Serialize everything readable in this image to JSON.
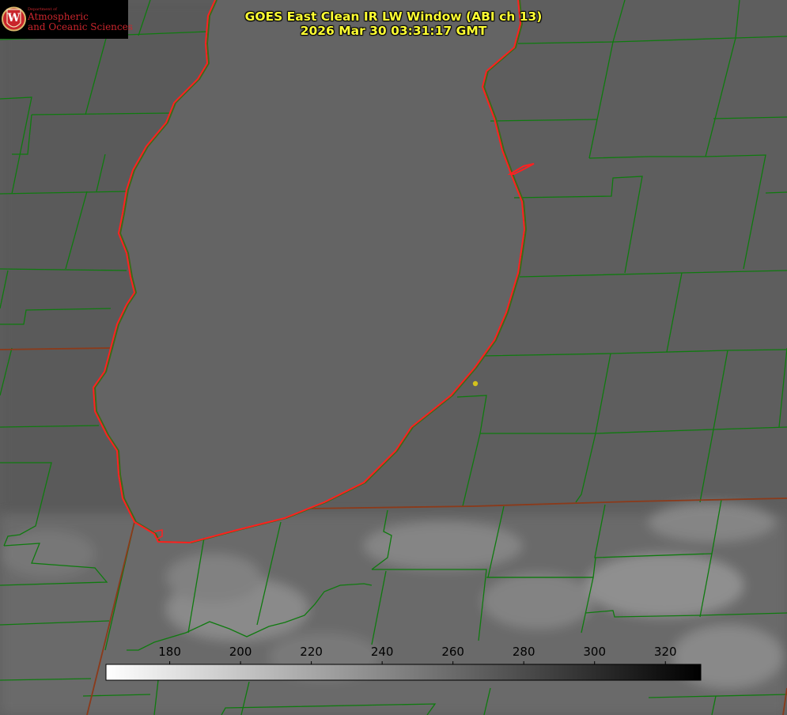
{
  "title": "GOES East Clean IR LW Window (ABI ch 13)",
  "timestamp": "2026 Mar 30 03:31:17 GMT",
  "logo": {
    "department": "Department of",
    "name_line1": "Atmospheric",
    "name_line2": "and Oceanic Sciences",
    "seal_letter": "W"
  },
  "colorbar": {
    "ticks": [
      {
        "label": "180",
        "value": 180
      },
      {
        "label": "200",
        "value": 200
      },
      {
        "label": "220",
        "value": 220
      },
      {
        "label": "240",
        "value": 240
      },
      {
        "label": "260",
        "value": 260
      },
      {
        "label": "280",
        "value": 280
      },
      {
        "label": "300",
        "value": 300
      },
      {
        "label": "320",
        "value": 320
      }
    ],
    "min": 162,
    "max": 330,
    "start_color": "#ffffff",
    "end_color": "#000000"
  },
  "colors": {
    "title": "#ffff33",
    "coastline": "#ff2020",
    "county_lines": "#0f7a0f",
    "state_lines": "#8b3a1a",
    "marker": "#d4c21c"
  }
}
